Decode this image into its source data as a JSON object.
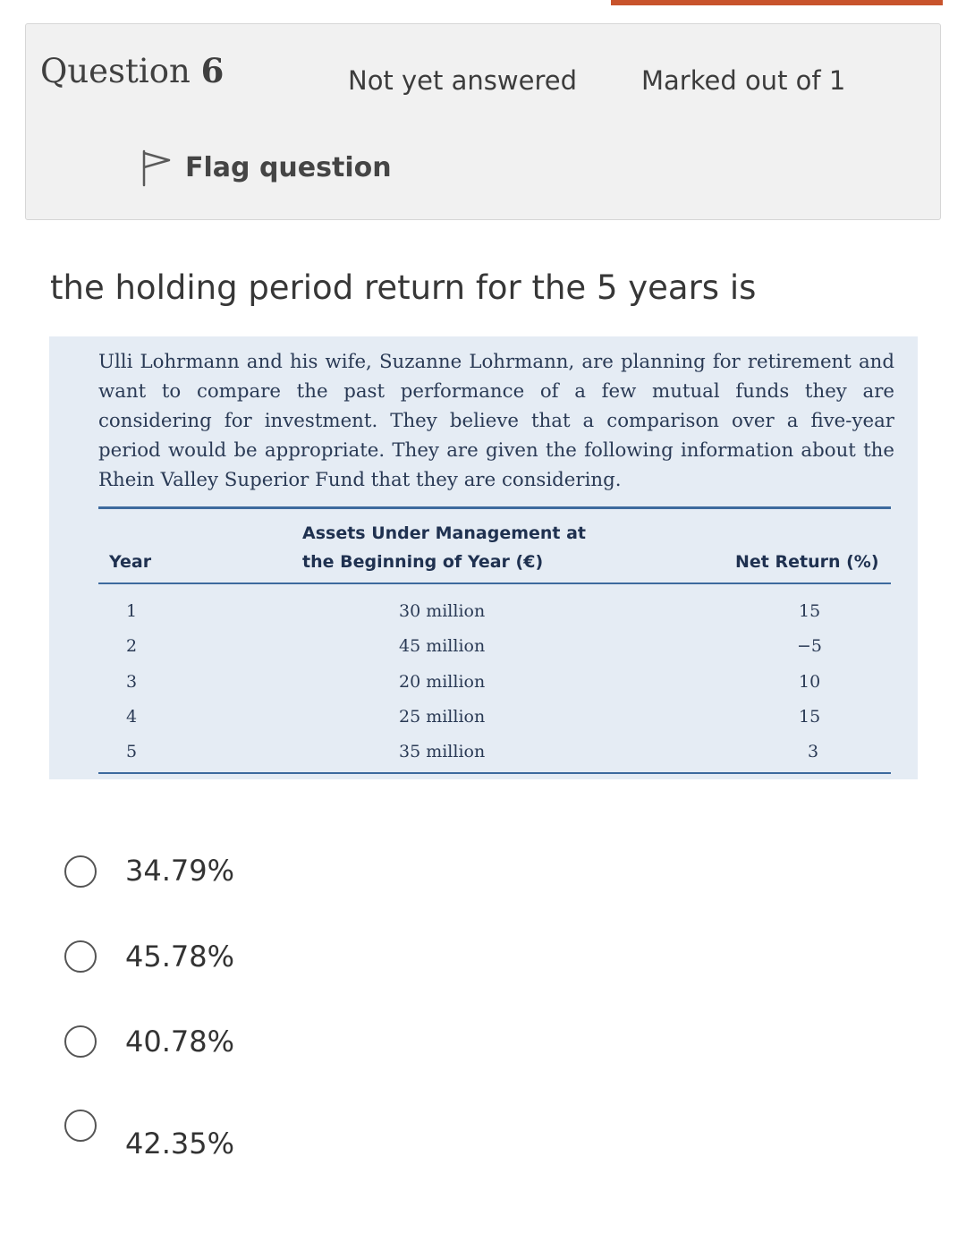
{
  "header": {
    "question_word": "Question",
    "question_number": "6",
    "state": "Not yet answered",
    "grade": "Marked out of 1",
    "flag_label": "Flag question",
    "flag_icon": "flag-icon",
    "accent_color": "#c8532c"
  },
  "question": {
    "prompt": "the holding period return for the 5 years is",
    "problem_text": "Ulli Lohrmann and his wife, Suzanne Lohrmann, are planning for retirement and want to compare the past performance of a few mutual funds they are considering for investment. They believe that a comparison over a five-year period would be appropriate. They are given the following information about the Rhein Valley Superior Fund that they are considering.",
    "table": {
      "headers": {
        "year": "Year",
        "aum_line1": "Assets Under Management at",
        "aum_line2": "the Beginning of Year (€)",
        "net_return": "Net Return (%)"
      },
      "rows": [
        {
          "year": "1",
          "aum": "30 million",
          "net_return": "15"
        },
        {
          "year": "2",
          "aum": "45 million",
          "net_return": "−5"
        },
        {
          "year": "3",
          "aum": "20 million",
          "net_return": "10"
        },
        {
          "year": "4",
          "aum": "25 million",
          "net_return": "15"
        },
        {
          "year": "5",
          "aum": "35 million",
          "net_return": "3"
        }
      ]
    }
  },
  "options": [
    {
      "label": "34.79%",
      "selected": false
    },
    {
      "label": "45.78%",
      "selected": false
    },
    {
      "label": "40.78%",
      "selected": false
    },
    {
      "label": "42.35%",
      "selected": false
    }
  ]
}
